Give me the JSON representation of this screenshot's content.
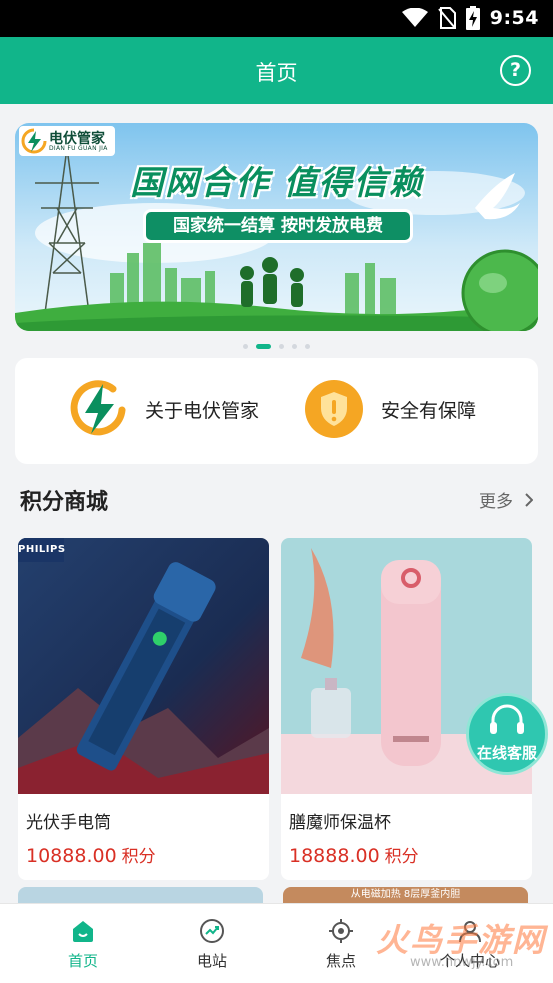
{
  "status_bar": {
    "time": "9:54",
    "icons": [
      "wifi-icon",
      "no-sim-icon",
      "battery-charging-icon"
    ]
  },
  "header": {
    "title": "首页",
    "help_icon": "question-icon",
    "help_glyph": "?"
  },
  "banner": {
    "logo_title": "电伏管家",
    "logo_subtitle": "DIAN FU GUAN JIA",
    "headline": "国网合作 值得信赖",
    "subline": "国家统一结算 按时发放电费",
    "dots_count": 5,
    "active_dot_index": 1
  },
  "quick_links": [
    {
      "label": "关于电伏管家",
      "icon": "lightning-logo-icon"
    },
    {
      "label": "安全有保障",
      "icon": "shield-icon"
    }
  ],
  "mall": {
    "title": "积分商城",
    "more_label": "更多",
    "products": [
      {
        "name": "光伏手电筒",
        "price": "10888.00",
        "unit": "积分",
        "image": "flashlight-image",
        "brand_tag": "PHILIPS"
      },
      {
        "name": "膳魔师保温杯",
        "price": "18888.00",
        "unit": "积分",
        "image": "thermos-bottle-image"
      }
    ],
    "next_row_banner_text": "从电磁加热 8层厚釜内胆"
  },
  "customer_service": {
    "label": "在线客服",
    "icon": "headset-icon"
  },
  "tabbar": {
    "active_index": 0,
    "tabs": [
      {
        "label": "首页",
        "icon": "home-icon"
      },
      {
        "label": "电站",
        "icon": "power-station-icon"
      },
      {
        "label": "焦点",
        "icon": "focus-target-icon"
      },
      {
        "label": "个人中心",
        "icon": "user-icon"
      }
    ]
  },
  "watermark": {
    "text": "火鸟手游网",
    "url": "www.hnwjy.com"
  },
  "colors": {
    "brand_green": "#11b58a",
    "price_red": "#d93025",
    "cs_teal": "#2fc7b0",
    "shield_orange": "#f5a623"
  }
}
